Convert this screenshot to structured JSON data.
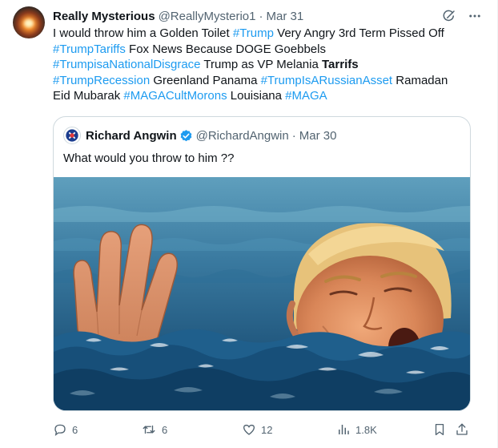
{
  "tweet": {
    "author": {
      "display_name": "Really Mysterious",
      "handle": "@ReallyMysterio1",
      "date": "Mar 31"
    },
    "text_lines": [
      [
        {
          "t": "I would throw him a Golden Toilet ",
          "k": "text"
        },
        {
          "t": "#Trump",
          "k": "hashtag"
        },
        {
          "t": " Very Angry 3rd Term Pissed Off",
          "k": "text"
        }
      ],
      [
        {
          "t": "#TrumpTariffs",
          "k": "hashtag"
        },
        {
          "t": " Fox News Because DOGE Goebbels",
          "k": "text"
        }
      ],
      [
        {
          "t": "#TrumpisaNationalDisgrace",
          "k": "hashtag"
        },
        {
          "t": " Trump as VP Melania ",
          "k": "text"
        },
        {
          "t": "Tarrifs",
          "k": "bold"
        }
      ],
      [
        {
          "t": "#TrumpRecession",
          "k": "hashtag"
        },
        {
          "t": " Greenland Panama ",
          "k": "text"
        },
        {
          "t": "#TrumpIsARussianAsset",
          "k": "hashtag"
        },
        {
          "t": " Ramadan",
          "k": "text"
        }
      ],
      [
        {
          "t": "Eid Mubarak ",
          "k": "text"
        },
        {
          "t": "#MAGACultMorons",
          "k": "hashtag"
        },
        {
          "t": " Louisiana ",
          "k": "text"
        },
        {
          "t": "#MAGA",
          "k": "hashtag"
        }
      ]
    ],
    "quoted": {
      "display_name": "Richard Angwin",
      "handle": "@RichardAngwin",
      "date": "Mar 30",
      "text": "What would you throw to him ??"
    },
    "metrics": {
      "replies": "6",
      "reposts": "6",
      "likes": "12",
      "views": "1.8K"
    },
    "icons": {
      "header": [
        "grok-icon",
        "more-icon"
      ],
      "actions": [
        "reply-icon",
        "repost-icon",
        "like-icon",
        "views-icon",
        "bookmark-icon",
        "share-icon"
      ]
    },
    "colors": {
      "text": "#0f1419",
      "muted": "#536471",
      "link": "#1d9bf0",
      "border": "#cfd9de",
      "verified": "#1d9bf0"
    }
  }
}
